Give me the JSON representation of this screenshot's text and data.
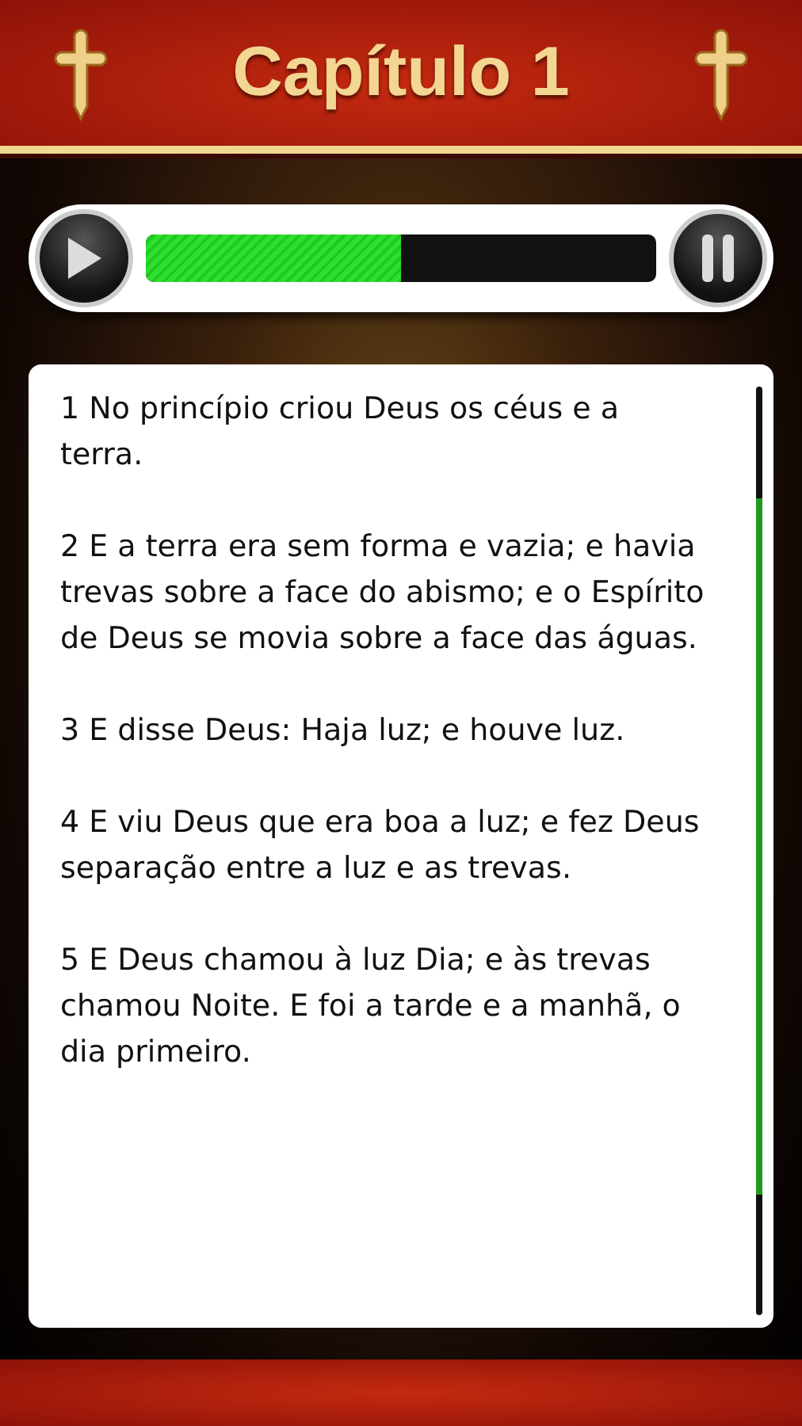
{
  "header": {
    "title": "Capítulo 1"
  },
  "player": {
    "level": 0.5
  },
  "verses": [
    {
      "text": "1 No princípio criou Deus os céus e a terra."
    },
    {
      "text": "2 E a terra era sem forma e vazia; e havia\ntrevas sobre a face do abismo; e o Espírito de Deus se movia sobre a face das águas."
    },
    {
      "text": "3 E disse Deus: Haja luz; e houve luz."
    },
    {
      "text": "4 E viu Deus que era boa a luz; e fez Deus separação entre a luz e as trevas."
    },
    {
      "text": "5 E Deus chamou à luz Dia; e às trevas chamou Noite. E foi a tarde e a manhã, o dia primeiro."
    }
  ]
}
